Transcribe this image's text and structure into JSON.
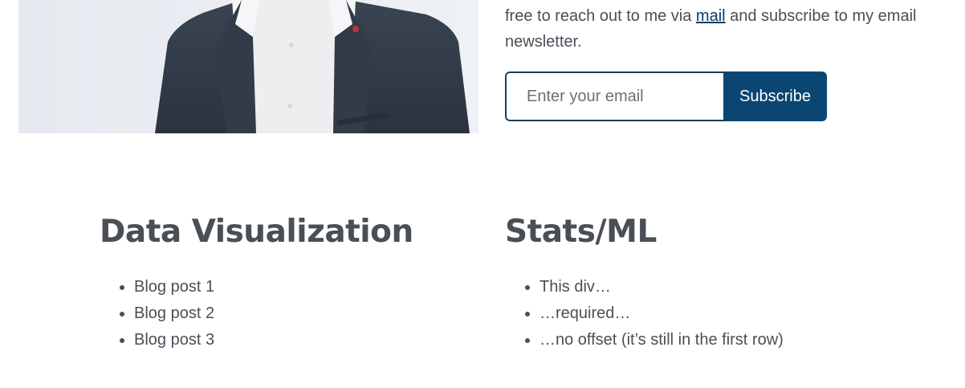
{
  "intro": {
    "text_before_link": "free to reach out to me via ",
    "link_label": "mail",
    "text_after_link": " and subscribe to my email newsletter."
  },
  "newsletter": {
    "email_placeholder": "Enter your email",
    "subscribe_label": "Subscribe"
  },
  "columns": [
    {
      "heading": "Data Visualization",
      "items": [
        "Blog post 1",
        "Blog post 2",
        "Blog post 3"
      ]
    },
    {
      "heading": "Stats/ML",
      "items": [
        "This div…",
        "…required…",
        "…no offset (it’s still in the first row)"
      ]
    }
  ],
  "colors": {
    "text": "#4a4f57",
    "accent": "#0b4673",
    "link": "#0a3d6b"
  }
}
